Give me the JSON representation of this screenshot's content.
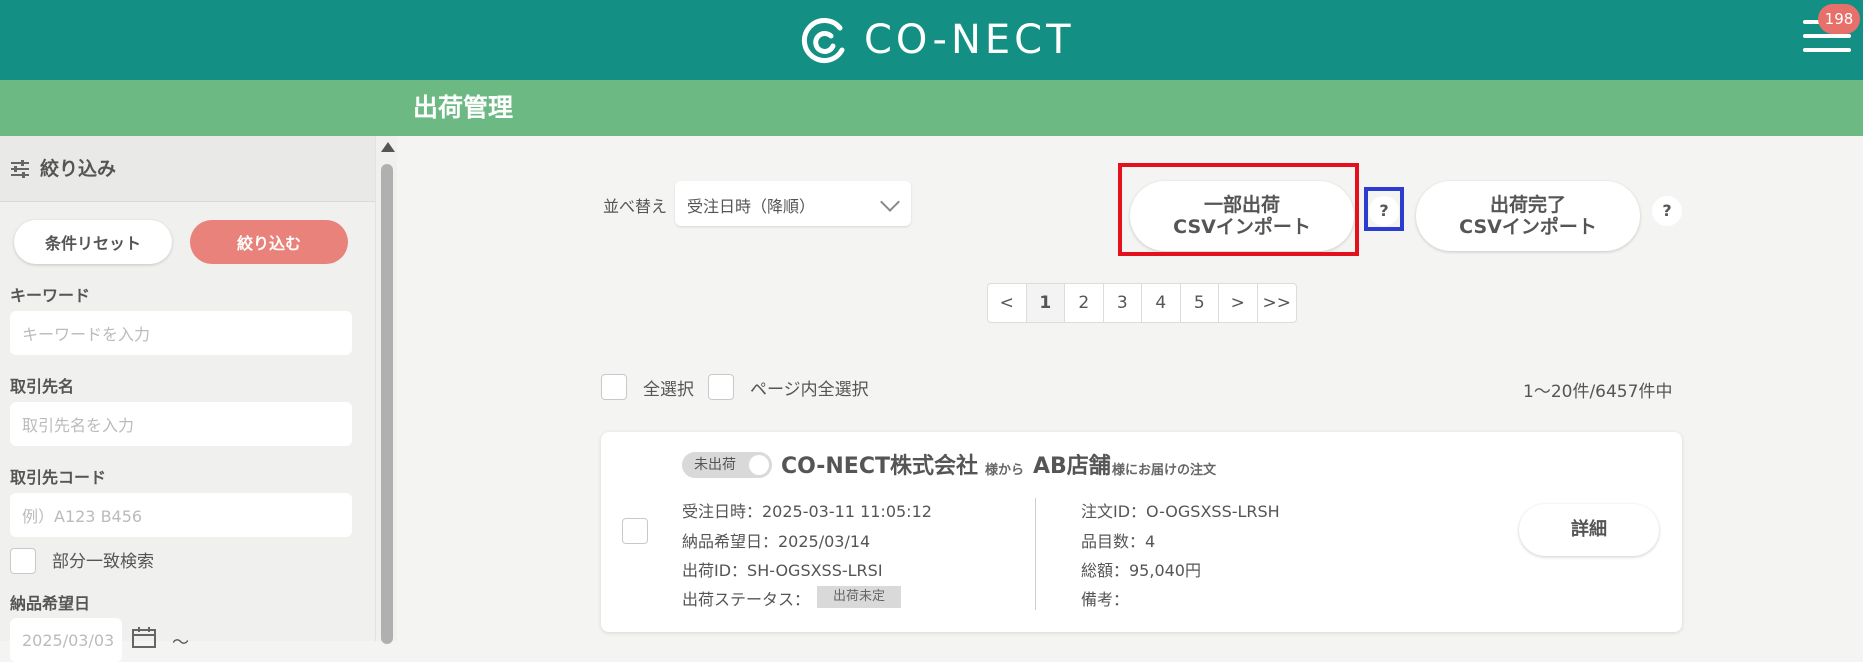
{
  "header": {
    "logo_text": "CO-NECT",
    "badge_count": "198",
    "accent": "#148f84"
  },
  "titlebar": {
    "title": "出荷管理",
    "color": "#6cb983"
  },
  "sidebar": {
    "title": "絞り込み",
    "reset_label": "条件リセット",
    "apply_label": "絞り込む",
    "keyword": {
      "label": "キーワード",
      "placeholder": "キーワードを入力"
    },
    "partner": {
      "label": "取引先名",
      "placeholder": "取引先名を入力"
    },
    "partner_code": {
      "label": "取引先コード",
      "placeholder": "例）A123 B456"
    },
    "partial_match_label": "部分一致検索",
    "delivery": {
      "label": "納品希望日",
      "placeholder": "2025/03/03",
      "tilde": "〜"
    }
  },
  "toolbar": {
    "sort_label": "並べ替え",
    "sort_value": "受注日時（降順）",
    "partial_csv": {
      "line1": "一部出荷",
      "line2": "CSVインポート"
    },
    "complete_csv": {
      "line1": "出荷完了",
      "line2": "CSVインポート"
    },
    "help": "?"
  },
  "pagination": {
    "items": [
      "<",
      "1",
      "2",
      "3",
      "4",
      "5",
      ">",
      ">>"
    ],
    "current": "1"
  },
  "selection": {
    "select_all": "全選択",
    "select_page": "ページ内全選択",
    "count": "1〜20件/6457件中"
  },
  "order": {
    "status_pill": "未出荷",
    "company": "CO-NECT株式会社",
    "from_suffix": "様から",
    "shop": "AB店舗",
    "to_suffix": "様にお届けの注文",
    "order_datetime": "受注日時：2025-03-11 11:05:12",
    "delivery_date": "納品希望日：2025/03/14",
    "shipment_id": "出荷ID：SH-OGSXSS-LRSI",
    "shipment_status_label": "出荷ステータス：",
    "shipment_status": "出荷未定",
    "order_id": "注文ID：O-OGSXSS-LRSH",
    "item_count": "品目数：4",
    "total": "総額：95,040円",
    "note": "備考：",
    "detail_label": "詳細"
  }
}
